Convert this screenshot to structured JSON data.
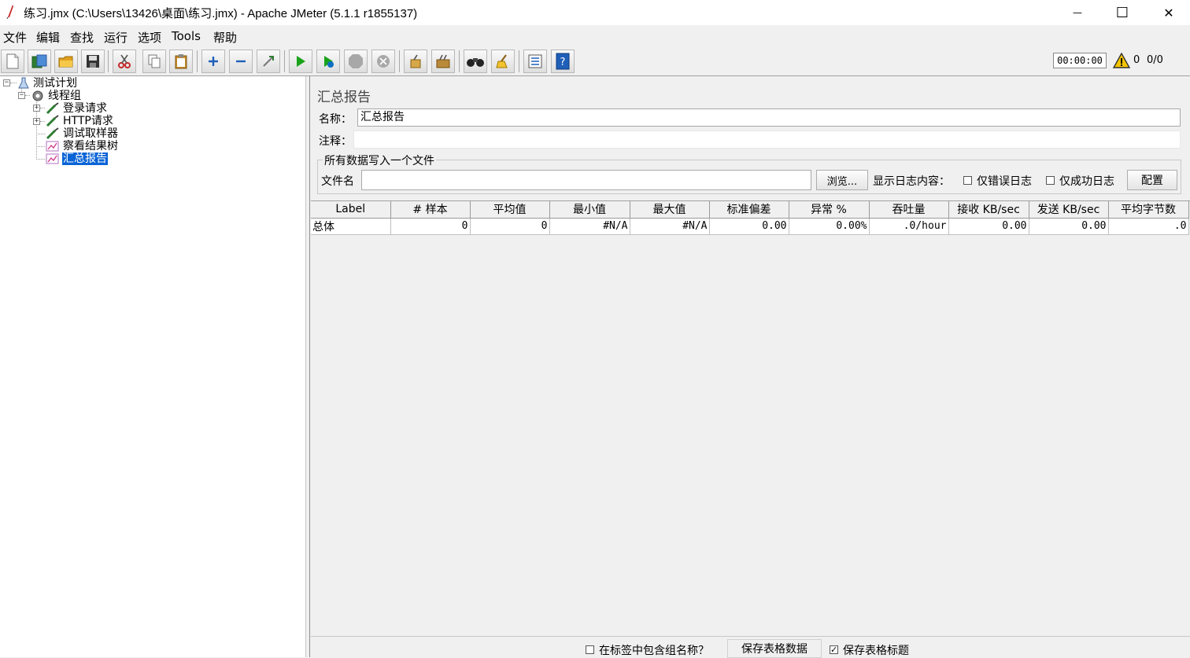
{
  "window": {
    "title": "练习.jmx (C:\\Users\\13426\\桌面\\练习.jmx) - Apache JMeter (5.1.1 r1855137)",
    "minimize_symbol": "—",
    "maximize_symbol": "☐",
    "close_symbol": "✕"
  },
  "menu": [
    "文件",
    "编辑",
    "查找",
    "运行",
    "选项",
    "Tools",
    "帮助"
  ],
  "toolbar": {
    "icons": [
      "new-icon",
      "templates-icon",
      "open-icon",
      "save-icon",
      "cut-icon",
      "copy-icon",
      "paste-icon",
      "expand-all-icon",
      "collapse-all-icon",
      "toggle-icon",
      "start-icon",
      "start-no-pause-icon",
      "stop-icon",
      "shutdown-icon",
      "clear-icon",
      "clear-all-icon",
      "search-icon",
      "reset-search-icon",
      "function-helper-icon",
      "help-icon"
    ],
    "timer": "00:00:00",
    "warning_count": "0",
    "thread_count": "0/0"
  },
  "tree": {
    "root": "测试计划",
    "thread_group": "线程组",
    "items": [
      "登录请求",
      "HTTP请求",
      "调试取样器",
      "察看结果树",
      "汇总报告"
    ],
    "expander_collapsed": "+",
    "expander_expanded": "−"
  },
  "panel": {
    "title": "汇总报告",
    "name_label": "名称：",
    "name_value": "汇总报告",
    "comment_label": "注释：",
    "comment_value": "",
    "file_group_legend": "所有数据写入一个文件",
    "filename_label": "文件名",
    "filename_value": "",
    "browse_button": "浏览...",
    "log_content_label": "显示日志内容：",
    "errors_only_label": "仅错误日志",
    "success_only_label": "仅成功日志",
    "configure_button": "配置"
  },
  "table": {
    "headers": [
      "Label",
      "# 样本",
      "平均值",
      "最小值",
      "最大值",
      "标准偏差",
      "异常 %",
      "吞吐量",
      "接收 KB/sec",
      "发送 KB/sec",
      "平均字节数"
    ],
    "rows": [
      [
        "总体",
        "0",
        "0",
        "#N/A",
        "#N/A",
        "0.00",
        "0.00%",
        ".0/hour",
        "0.00",
        "0.00",
        ".0"
      ]
    ]
  },
  "bottom": {
    "include_group_label": "在标签中包含组名称？",
    "save_table_data_button": "保存表格数据",
    "save_table_header_label": "保存表格标题",
    "save_table_header_checked": "✓"
  },
  "colors": {
    "selection": "#0a64d6",
    "window_bg": "#f0f0f0"
  }
}
